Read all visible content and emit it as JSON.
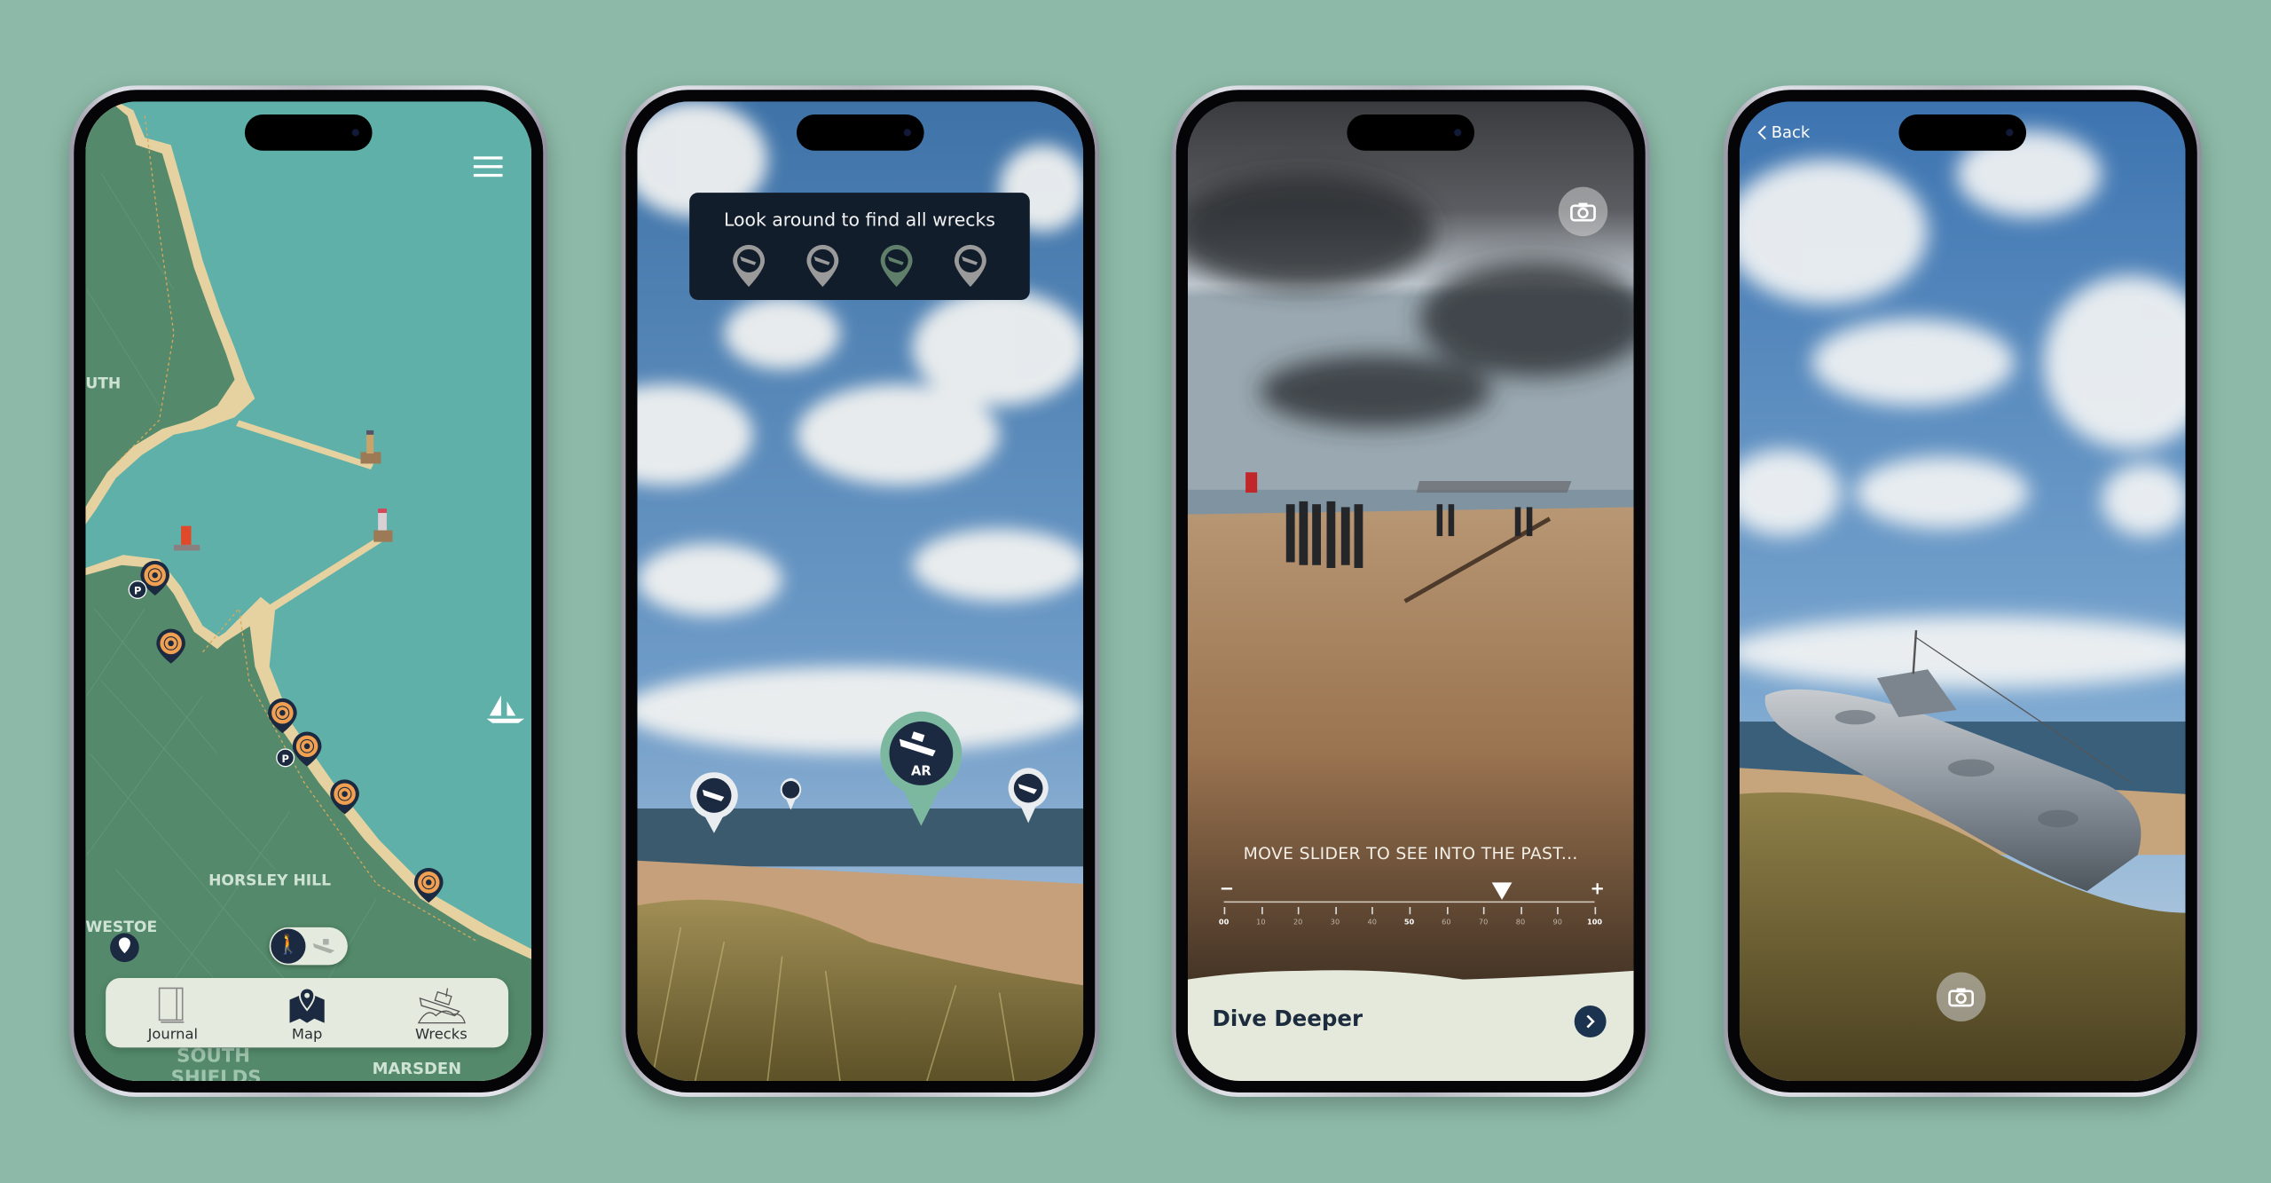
{
  "colors": {
    "background": "#8dbaa8",
    "sea": "#5fb0a8",
    "land": "#548a6b",
    "sand": "#e6d1a0",
    "marker_orange": "#f0a050",
    "navy": "#1b2a40",
    "panel": "#e5eadf"
  },
  "map_screen": {
    "place_labels": [
      "UTH",
      "HORSLEY HILL",
      "WESTOE",
      "SOUTH",
      "SHIELDS",
      "MARSDEN"
    ],
    "menu_icon": "hamburger-icon",
    "mode_toggle": {
      "active": "walking",
      "options": [
        "hiker-icon",
        "shipwreck-icon"
      ]
    },
    "nav": [
      {
        "label": "Journal",
        "icon": "book-icon",
        "active": false
      },
      {
        "label": "Map",
        "icon": "map-pin-icon",
        "active": true
      },
      {
        "label": "Wrecks",
        "icon": "shipwreck-icon",
        "active": false
      }
    ]
  },
  "ar_screen": {
    "hint": "Look around to find all wrecks",
    "wreck_progress": [
      {
        "found": false
      },
      {
        "found": false
      },
      {
        "found": true
      },
      {
        "found": false
      }
    ],
    "ar_marker_label": "AR"
  },
  "past_screen": {
    "camera_icon": "camera-icon",
    "instruction": "MOVE SLIDER TO SEE INTO THE PAST...",
    "slider": {
      "minus": "−",
      "plus": "+",
      "ticks": [
        "00",
        "10",
        "20",
        "30",
        "40",
        "50",
        "60",
        "70",
        "80",
        "90",
        "100"
      ],
      "value": 75
    },
    "cta": "Dive Deeper"
  },
  "sub_screen": {
    "back_label": "Back",
    "camera_icon": "camera-icon"
  }
}
